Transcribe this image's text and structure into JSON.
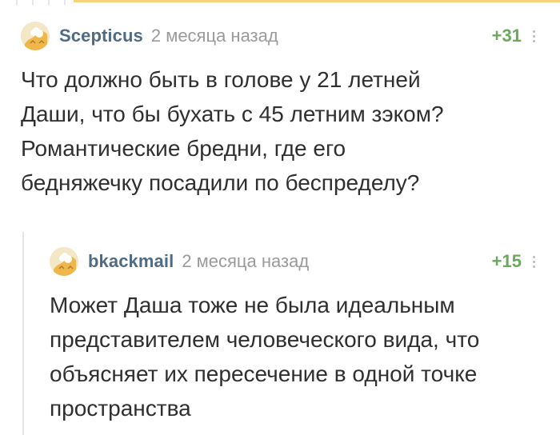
{
  "comment1": {
    "username": "Scepticus",
    "time": "2 месяца назад",
    "rating": "+31",
    "text_lines": [
      "Что должно быть в голове у 21 летней",
      "Даши, что бы бухать с 45 летним зэком?",
      "Романтические бредни, где его",
      "бедняжечку посадили по беспределу?"
    ]
  },
  "comment2": {
    "username": "bkackmail",
    "time": "2 месяца назад",
    "rating": "+15",
    "text_lines": [
      "Может Даша  тоже не была идеальным",
      "представителем человеческого вида, что",
      "объясняет их пересечение в одной точке",
      "пространства"
    ]
  },
  "icons": {
    "avatar": "default-avatar-icon",
    "menu": "kebab-menu-icon"
  },
  "colors": {
    "username": "#4f6b83",
    "time": "#9a9a9a",
    "rating": "#6aa85a",
    "text": "#2f2f2f",
    "thread_line": "#e6e6e6",
    "top_accent": "#f6d37a"
  }
}
